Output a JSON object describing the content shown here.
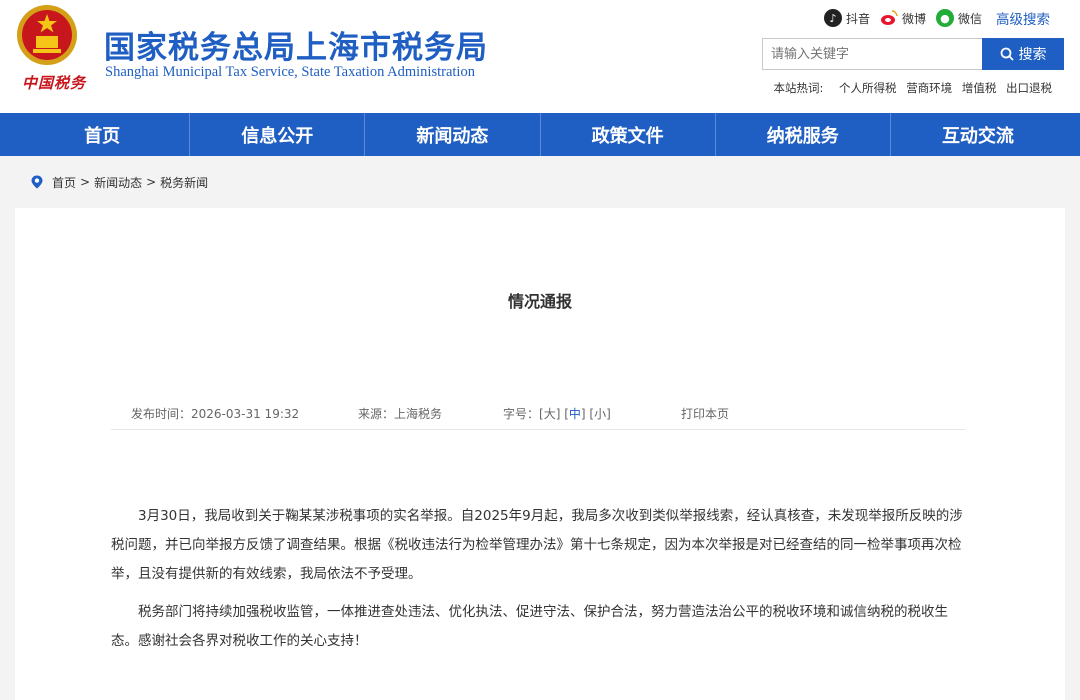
{
  "header": {
    "emblem_caption": "中国税务",
    "title": "国家税务总局上海市税务局",
    "subtitle": "Shanghai Municipal Tax Service, State Taxation Administration",
    "social": [
      {
        "label": "抖音",
        "icon": "douyin-icon"
      },
      {
        "label": "微博",
        "icon": "weibo-icon"
      },
      {
        "label": "微信",
        "icon": "weixin-icon"
      }
    ],
    "advanced_search": "高级搜索",
    "search": {
      "placeholder": "请输入关键字",
      "button": "搜索"
    },
    "hot": {
      "label": "本站热词:",
      "items": [
        "个人所得税",
        "营商环境",
        "增值税",
        "出口退税"
      ]
    }
  },
  "nav": [
    "首页",
    "信息公开",
    "新闻动态",
    "政策文件",
    "纳税服务",
    "互动交流"
  ],
  "breadcrumb": [
    "首页",
    "新闻动态",
    "税务新闻"
  ],
  "article": {
    "title": "情况通报",
    "meta": {
      "published": "发布时间：2026-03-31 19:32",
      "source": "来源：上海税务",
      "font_label": "字号：",
      "font_large": "大",
      "font_medium": "中",
      "font_small": "小",
      "print": "打印本页"
    },
    "paragraphs": [
      "3月30日，我局收到关于鞠某某涉税事项的实名举报。自2025年9月起，我局多次收到类似举报线索，经认真核查，未发现举报所反映的涉税问题，并已向举报方反馈了调查结果。根据《税收违法行为检举管理办法》第十七条规定，因为本次举报是对已经查结的同一检举事项再次检举，且没有提供新的有效线索，我局依法不予受理。",
      "税务部门将持续加强税收监管，一体推进查处违法、优化执法、促进守法、保护合法，努力营造法治公平的税收环境和诚信纳税的税收生态。感谢社会各界对税收工作的关心支持！"
    ]
  },
  "colors": {
    "brand": "#1f5ec2",
    "emblem_red": "#c8161d"
  }
}
